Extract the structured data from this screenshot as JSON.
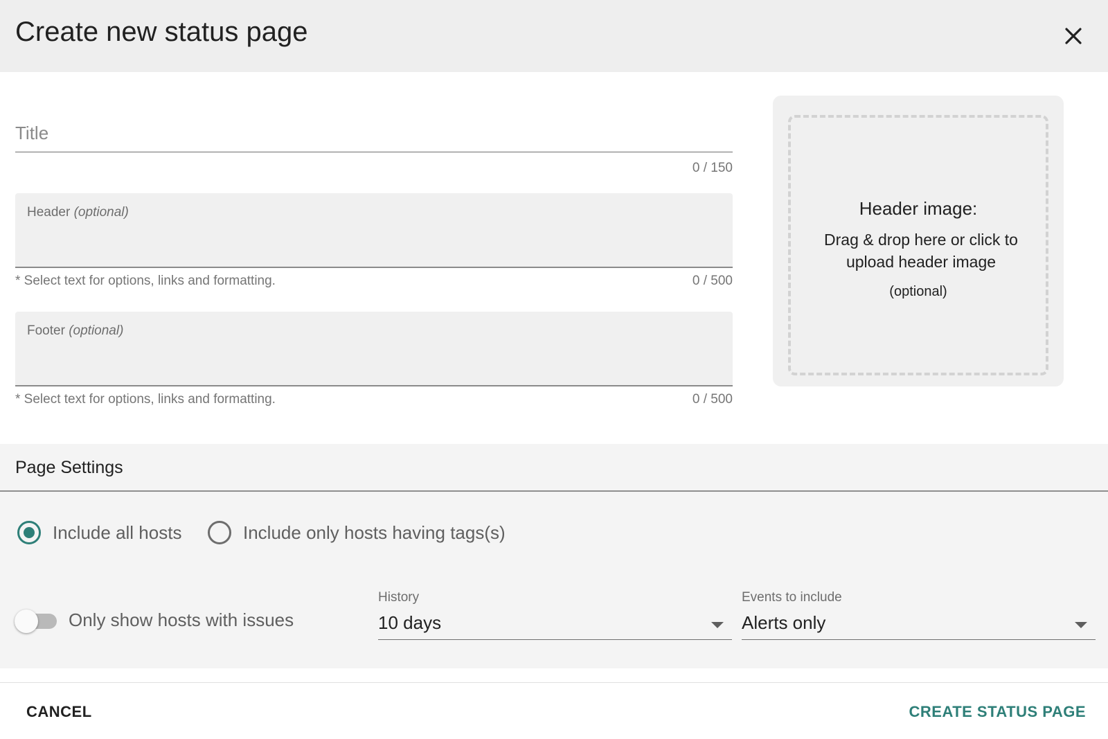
{
  "dialog": {
    "title": "Create new status page",
    "close_icon": "close-icon"
  },
  "title_field": {
    "placeholder": "Title",
    "value": "",
    "counter": "0 / 150"
  },
  "header_field": {
    "label": "Header",
    "optional": "(optional)",
    "hint": "* Select text for options, links and formatting.",
    "counter": "0 / 500"
  },
  "footer_field": {
    "label": "Footer",
    "optional": "(optional)",
    "hint": "* Select text for options, links and formatting.",
    "counter": "0 / 500"
  },
  "header_image": {
    "title": "Header image:",
    "description": "Drag & drop here or click to upload header image",
    "optional": "(optional)"
  },
  "settings": {
    "title": "Page Settings",
    "host_scope": {
      "options": [
        "Include all hosts",
        "Include only hosts having tags(s)"
      ],
      "selected": "Include all hosts"
    },
    "only_issues": {
      "label": "Only show hosts with issues",
      "enabled": false
    },
    "history": {
      "label": "History",
      "value": "10 days"
    },
    "events": {
      "label": "Events to include",
      "value": "Alerts only"
    }
  },
  "actions": {
    "cancel": "CANCEL",
    "create": "CREATE STATUS PAGE"
  },
  "colors": {
    "accent": "#2e7f78",
    "header_bg": "#eeeeee",
    "settings_bg": "#f4f4f4"
  }
}
